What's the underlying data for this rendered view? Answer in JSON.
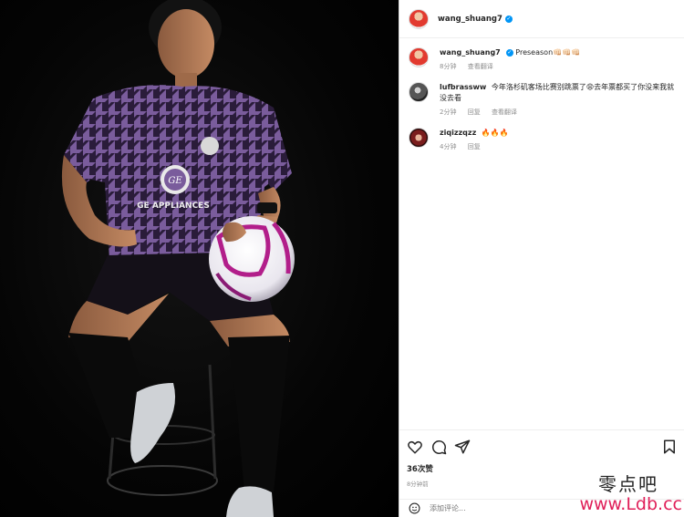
{
  "post": {
    "author": "wang_shuang7",
    "verified": true
  },
  "caption": {
    "author": "wang_shuang7",
    "text": "Preseason👊🏻👊🏻👊🏻",
    "time": "8分钟",
    "see_translation": "查看翻译"
  },
  "comments": [
    {
      "user": "lufbrassww",
      "text": "今年洛杉矶客场比赛别跳票了😩去年票都买了你没来我就没去看",
      "time": "2分钟",
      "reply": "回复",
      "see_translation": "查看翻译"
    },
    {
      "user": "ziqizzqzz",
      "text": "🔥🔥🔥",
      "time": "4分钟",
      "reply": "回复"
    }
  ],
  "actions": {
    "likes": "36次赞",
    "time_ago": "8分钟前"
  },
  "add_comment": {
    "placeholder": "添加评论..."
  },
  "photo": {
    "jersey_sponsor": "GE APPLIANCES",
    "sponsor_logo": "GE"
  },
  "watermark": {
    "chinese": "零点吧",
    "url": "www.Ldb.cc"
  },
  "colors": {
    "verified_blue": "#0095f6",
    "jersey_purple": "#6b4a8e",
    "watermark_pink": "#e0205a"
  }
}
